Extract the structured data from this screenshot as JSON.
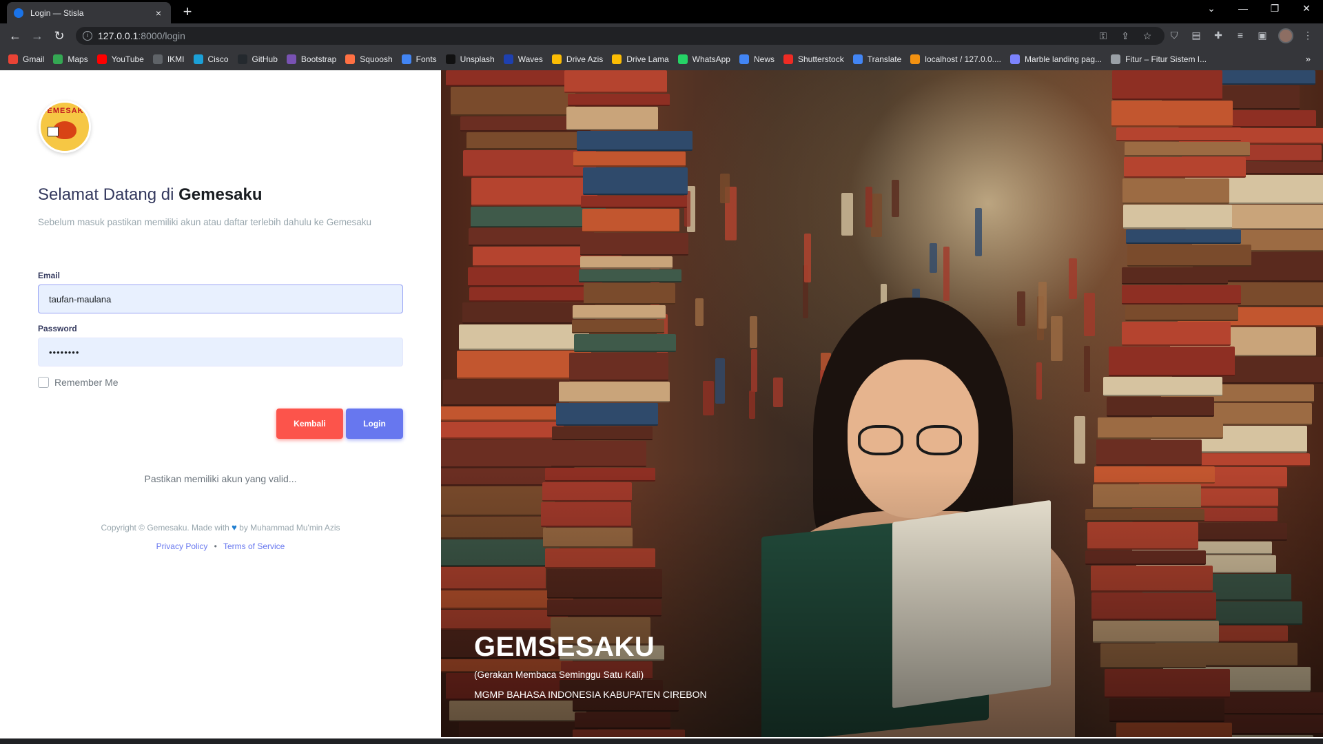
{
  "browser": {
    "tab_title": "Login — Stisla",
    "tab_close": "×",
    "new_tab": "+",
    "url_host": "127.0.0.1",
    "url_path": ":8000/login",
    "back": "←",
    "forward": "→",
    "reload": "↻",
    "bookmarks": [
      {
        "label": "Gmail",
        "color": "#ea4335"
      },
      {
        "label": "Maps",
        "color": "#34a853"
      },
      {
        "label": "YouTube",
        "color": "#ff0000"
      },
      {
        "label": "IKMI",
        "color": "#5f6368"
      },
      {
        "label": "Cisco",
        "color": "#1ba0d7"
      },
      {
        "label": "GitHub",
        "color": "#24292e"
      },
      {
        "label": "Bootstrap",
        "color": "#7952b3"
      },
      {
        "label": "Squoosh",
        "color": "#ff7043"
      },
      {
        "label": "Fonts",
        "color": "#4285f4"
      },
      {
        "label": "Unsplash",
        "color": "#111111"
      },
      {
        "label": "Waves",
        "color": "#1e40af"
      },
      {
        "label": "Drive Azis",
        "color": "#fbbc04"
      },
      {
        "label": "Drive Lama",
        "color": "#fbbc04"
      },
      {
        "label": "WhatsApp",
        "color": "#25d366"
      },
      {
        "label": "News",
        "color": "#4285f4"
      },
      {
        "label": "Shutterstock",
        "color": "#ee2b24"
      },
      {
        "label": "Translate",
        "color": "#4285f4"
      },
      {
        "label": "localhost / 127.0.0....",
        "color": "#f29111"
      },
      {
        "label": "Marble landing pag...",
        "color": "#7c83fd"
      },
      {
        "label": "Fitur – Fitur Sistem I...",
        "color": "#9aa0a6"
      }
    ],
    "bookmarks_more": "»"
  },
  "login": {
    "welcome_prefix": "Selamat Datang di",
    "welcome_brand": "Gemesaku",
    "subtitle": "Sebelum masuk pastikan memiliki akun atau daftar terlebih dahulu ke Gemesaku",
    "email_label": "Email",
    "email_value": "taufan-maulana",
    "password_label": "Password",
    "password_value": "••••••••",
    "remember_label": "Remember Me",
    "back_button": "Kembali",
    "login_button": "Login",
    "hint": "Pastikan memiliki akun yang valid...",
    "copyright_prefix": "Copyright © Gemesaku. Made with",
    "copyright_suffix": "by Muhammad Mu'min Azis",
    "privacy": "Privacy Policy",
    "terms": "Terms of Service",
    "bullet": "•",
    "logo_text": "GEMESAKU"
  },
  "hero": {
    "title": "GEMSESAKU",
    "subtitle": "(Gerakan Membaca Seminggu Satu Kali)",
    "org": "MGMP BAHASA INDONESIA KABUPATEN CIREBON"
  },
  "colors": {
    "primary": "#6777ef",
    "danger": "#fc544b"
  }
}
